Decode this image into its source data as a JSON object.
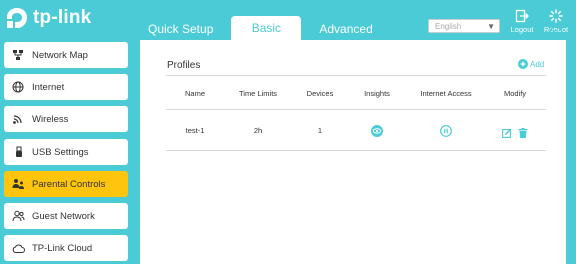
{
  "header": {
    "logo_text": "tp-link",
    "tabs": [
      {
        "label": "Quick Setup"
      },
      {
        "label": "Basic"
      },
      {
        "label": "Advanced"
      }
    ],
    "language": {
      "value": "English"
    },
    "logout_label": "Logout",
    "reboot_label": "Reboot"
  },
  "sidebar": {
    "items": [
      {
        "label": "Network Map",
        "icon": "network-map-icon"
      },
      {
        "label": "Internet",
        "icon": "globe-icon"
      },
      {
        "label": "Wireless",
        "icon": "wifi-icon"
      },
      {
        "label": "USB Settings",
        "icon": "usb-icon"
      },
      {
        "label": "Parental Controls",
        "icon": "parental-controls-icon"
      },
      {
        "label": "Guest Network",
        "icon": "guest-icon"
      },
      {
        "label": "TP-Link Cloud",
        "icon": "cloud-icon"
      }
    ],
    "active": "Parental Controls"
  },
  "main": {
    "title": "Profiles",
    "add_label": "Add",
    "columns": [
      "Name",
      "Time Limits",
      "Devices",
      "Insights",
      "Internet Access",
      "Modify"
    ],
    "rows": [
      {
        "name": "test-1",
        "time_limits": "2h",
        "devices": "1"
      }
    ]
  },
  "colors": {
    "accent": "#4acbd6",
    "active_item": "#fec50c",
    "content_bg": "#ffffff"
  }
}
